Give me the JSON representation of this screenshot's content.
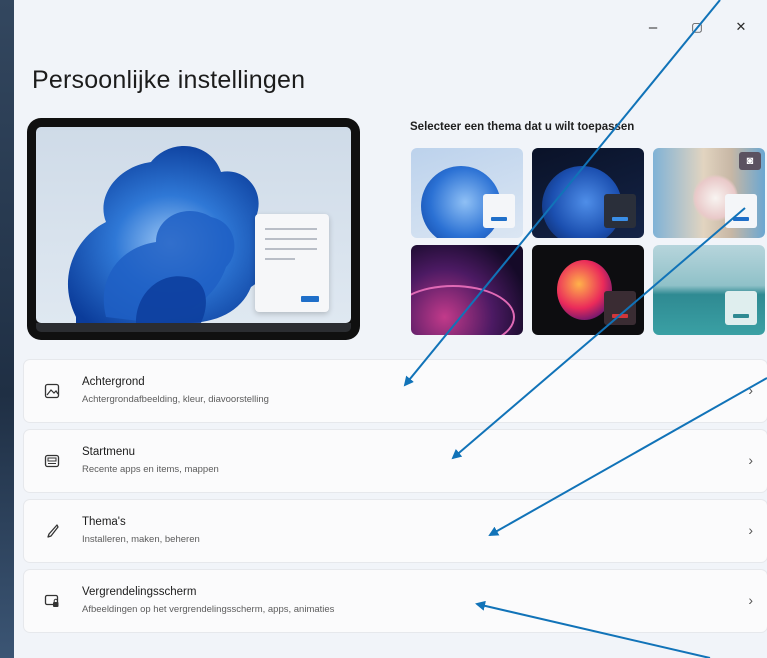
{
  "window": {
    "title": "Persoonlijke instellingen",
    "controls": {
      "minimize": "–",
      "maximize": "▢",
      "close": "✕"
    }
  },
  "themes": {
    "label": "Selecteer een thema dat u wilt toepassen",
    "count": 6
  },
  "items": [
    {
      "title": "Achtergrond",
      "subtitle": "Achtergrondafbeelding, kleur, diavoorstelling",
      "icon": "image-icon"
    },
    {
      "title": "Startmenu",
      "subtitle": "Recente apps en items, mappen",
      "icon": "start-menu-icon"
    },
    {
      "title": "Thema's",
      "subtitle": "Installeren, maken, beheren",
      "icon": "brush-icon"
    },
    {
      "title": "Vergrendelingsscherm",
      "subtitle": "Afbeeldingen op het vergrendelingsscherm, apps, animaties",
      "icon": "lock-screen-icon"
    }
  ],
  "chevron": "›",
  "colors": {
    "accent": "#1f6fc9",
    "arrow": "#1173b8",
    "background": "#f1f4f9"
  }
}
